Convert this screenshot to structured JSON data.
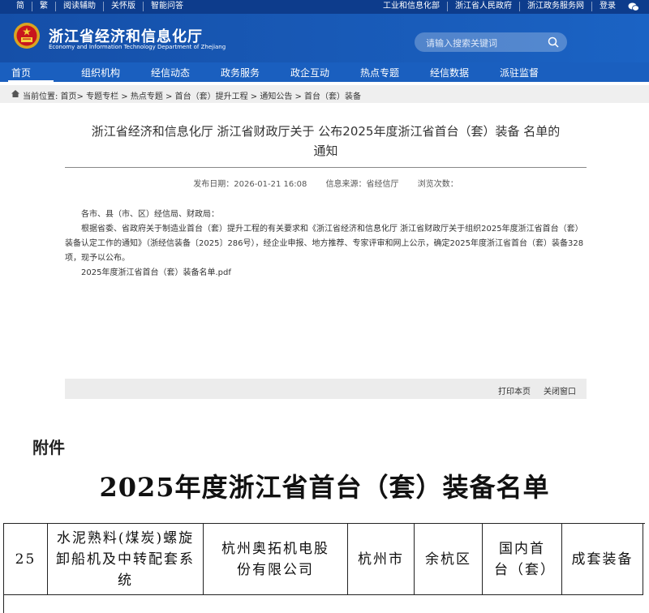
{
  "topbar": {
    "left_links": [
      "简",
      "繁",
      "阅读辅助",
      "关怀版",
      "智能问答"
    ],
    "right_links": [
      "工业和信息化部",
      "浙江省人民政府",
      "浙江政务服务网",
      "登录"
    ]
  },
  "header": {
    "title": "浙江省经济和信息化厅",
    "subtitle": "Economy and Information Technology Department of Zhejiang",
    "search_placeholder": "请输入搜索关键词"
  },
  "nav": [
    "首页",
    "组织机构",
    "经信动态",
    "政务服务",
    "政企互动",
    "热点专题",
    "经信数据",
    "派驻监督"
  ],
  "breadcrumb": "当前位置: 首页> 专题专栏 > 热点专题 > 首台（套）提升工程 > 通知公告 > 首台（套）装备",
  "article": {
    "title_line1": "浙江省经济和信息化厅 浙江省财政厅关于 公布2025年度浙江省首台（套）装备 名单的",
    "title_line2": "通知",
    "publish_date": "发布日期：2026-01-21 16:08",
    "source": "信息来源：省经信厅",
    "views": "浏览次数：",
    "salutation": "各市、县（市、区）经信局、财政局：",
    "paragraph": "根据省委、省政府关于制造业首台（套）提升工程的有关要求和《浙江省经济和信息化厅 浙江省财政厅关于组织2025年度浙江省首台（套）装备认定工作的通知》（浙经信装备〔2025〕286号），经企业申报、地方推荐、专家评审和网上公示，确定2025年度浙江省首台（套）装备328项，现予以公布。",
    "attachment": "2025年度浙江省首台（套）装备名单.pdf"
  },
  "tools": {
    "print": "打印本页",
    "close": "关闭窗口"
  },
  "document": {
    "attach_label": "附件",
    "list_title": "2025年度浙江省首台（套）装备名单",
    "row": {
      "no": "25",
      "name": "水泥熟料(煤炭)螺旋卸船机及中转配套系统",
      "company": "杭州奥拓机电股份有限公司",
      "city": "杭州市",
      "district": "余杭区",
      "level": "国内首台（套）",
      "category": "成套装备"
    }
  },
  "colors": {
    "topbar": "#0d3c8c",
    "header": "#1558b5",
    "nav": "#1a5fbf"
  }
}
